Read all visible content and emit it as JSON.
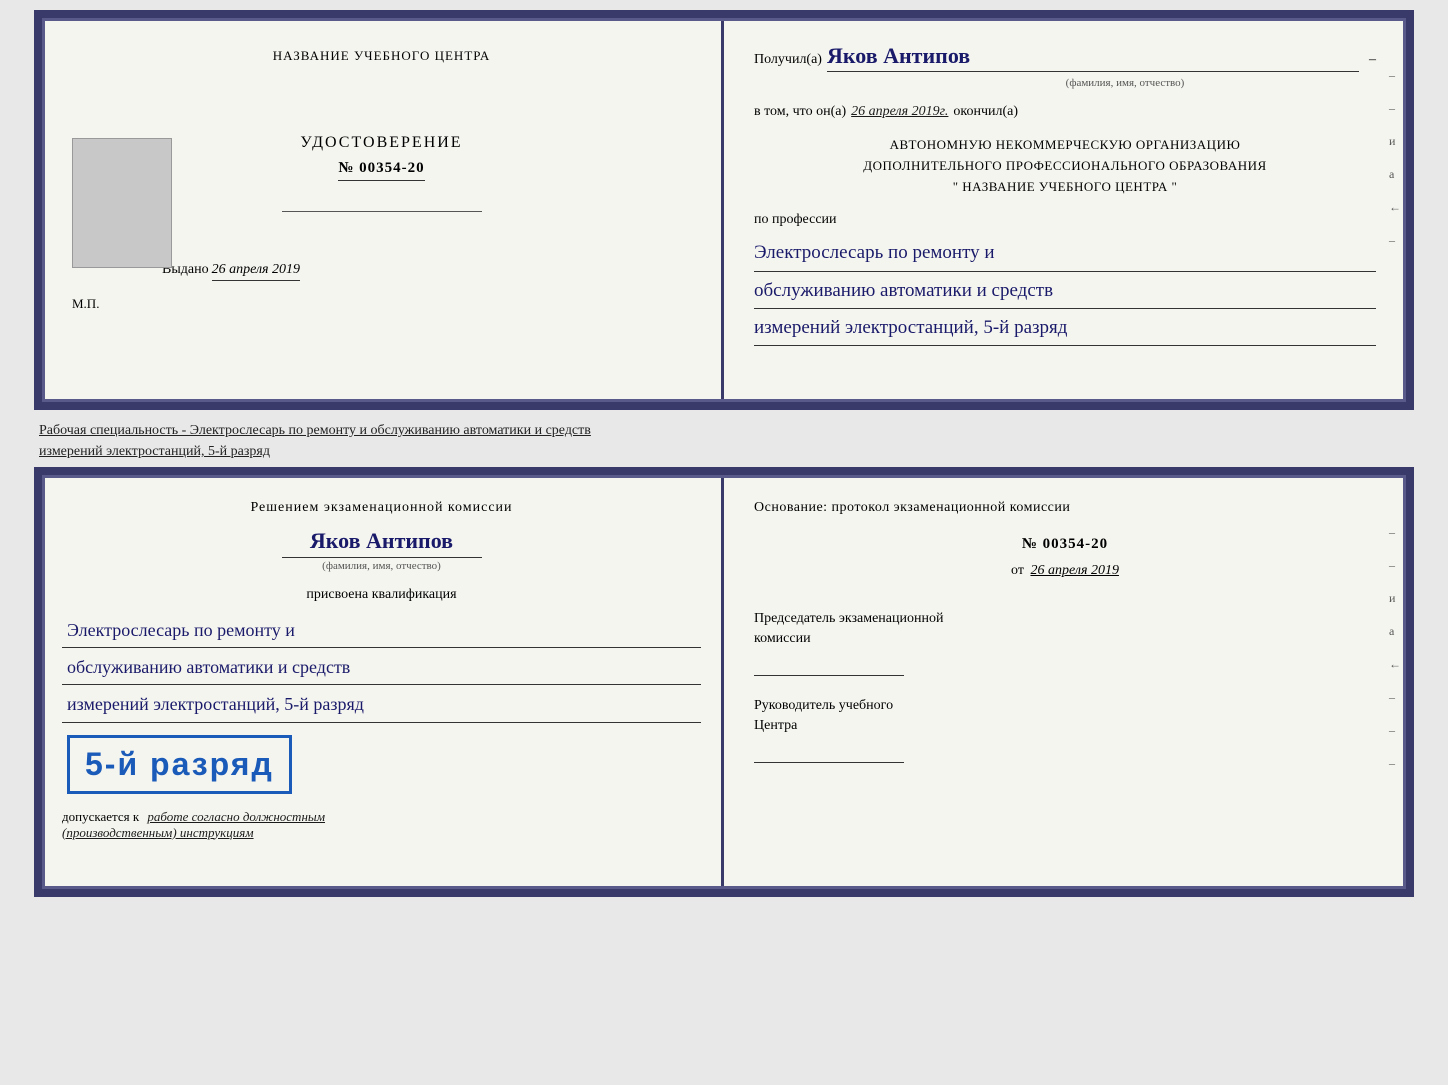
{
  "top_document": {
    "left_page": {
      "org_name": "НАЗВАНИЕ УЧЕБНОГО ЦЕНТРА",
      "cert_title": "УДОСТОВЕРЕНИЕ",
      "cert_number": "№ 00354-20",
      "issued_label": "Выдано",
      "issued_date": "26 апреля 2019",
      "stamp_label": "М.П."
    },
    "right_page": {
      "recipient_label": "Получил(а)",
      "recipient_name": "Яков Антипов",
      "fio_label": "(фамилия, имя, отчество)",
      "date_label": "в том, что он(а)",
      "date_value": "26 апреля 2019г.",
      "finished_label": "окончил(а)",
      "org_line1": "АВТОНОМНУЮ НЕКОММЕРЧЕСКУЮ ОРГАНИЗАЦИЮ",
      "org_line2": "ДОПОЛНИТЕЛЬНОГО ПРОФЕССИОНАЛЬНОГО ОБРАЗОВАНИЯ",
      "org_line3": "\"  НАЗВАНИЕ УЧЕБНОГО ЦЕНТРА  \"",
      "profession_label": "по профессии",
      "profession_line1": "Электрослесарь по ремонту и",
      "profession_line2": "обслуживанию автоматики и средств",
      "profession_line3": "измерений электростанций, 5-й разряд",
      "side_chars": [
        "-",
        "-",
        "и",
        "а",
        "←",
        "-"
      ]
    }
  },
  "info_text": {
    "line1": "Рабочая специальность - Электрослесарь по ремонту и обслуживанию автоматики и средств",
    "line2": "измерений электростанций, 5-й разряд"
  },
  "bottom_document": {
    "left_page": {
      "decision_text": "Решением экзаменационной комиссии",
      "person_name": "Яков Антипов",
      "fio_label": "(фамилия, имя, отчество)",
      "qualification_label": "присвоена квалификация",
      "profession_line1": "Электрослесарь по ремонту и",
      "profession_line2": "обслуживанию автоматики и средств",
      "profession_line3": "измерений электростанций, 5-й разряд",
      "rank_text": "5-й разряд",
      "admission_label": "допускается к",
      "admission_text": "работе согласно должностным",
      "admission_text2": "(производственным) инструкциям"
    },
    "right_page": {
      "basis_label": "Основание: протокол экзаменационной комиссии",
      "protocol_number": "№  00354-20",
      "protocol_date_prefix": "от",
      "protocol_date": "26 апреля 2019",
      "chairman_title_line1": "Председатель экзаменационной",
      "chairman_title_line2": "комиссии",
      "head_title_line1": "Руководитель учебного",
      "head_title_line2": "Центра",
      "side_chars": [
        "-",
        "-",
        "и",
        "а",
        "←",
        "-",
        "-",
        "-"
      ]
    }
  }
}
